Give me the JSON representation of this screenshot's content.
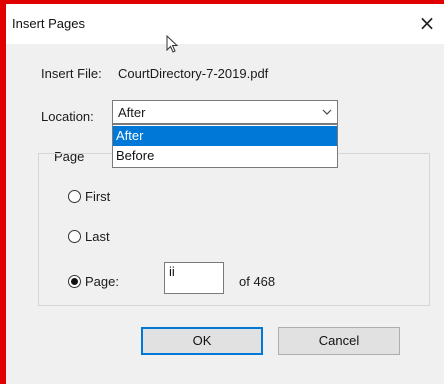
{
  "window": {
    "title": "Insert Pages"
  },
  "insert_file": {
    "label": "Insert File:",
    "name": "CourtDirectory-7-2019.pdf"
  },
  "location": {
    "label": "Location:",
    "selected": "After",
    "options": [
      "After",
      "Before"
    ],
    "highlighted": "After"
  },
  "page_group": {
    "label": "Page",
    "first_label": "First",
    "last_label": "Last",
    "page_label": "Page:",
    "page_value": "ii",
    "of_total": "of 468",
    "selected": "Page"
  },
  "buttons": {
    "ok": "OK",
    "cancel": "Cancel"
  },
  "colors": {
    "frame": "#e00000",
    "selection": "#0078d7",
    "dialog_bg": "#f0f0f0"
  },
  "icons": {
    "close": "close-icon",
    "cursor": "mouse-cursor-icon",
    "dropdown": "chevron-down-icon"
  }
}
